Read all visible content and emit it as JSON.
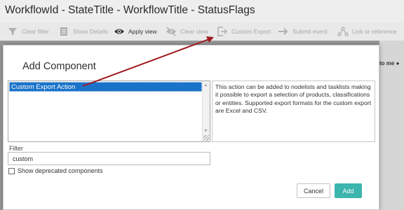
{
  "window": {
    "title": "WorkflowId - StateTitle - WorkflowTitle - StatusFlags"
  },
  "toolbar": {
    "items": [
      {
        "label": "Clear filter",
        "icon": "filter-icon",
        "enabled": false
      },
      {
        "label": "Show Details",
        "icon": "details-icon",
        "enabled": false
      },
      {
        "label": "Apply view",
        "icon": "eye-icon",
        "enabled": true
      },
      {
        "label": "Clear view",
        "icon": "eye-off-icon",
        "enabled": false
      },
      {
        "label": "Custom Export",
        "icon": "export-icon",
        "enabled": false
      },
      {
        "label": "Submit event",
        "icon": "submit-arrow-icon",
        "enabled": false
      },
      {
        "label": "Link or reference",
        "icon": "link-icon",
        "enabled": false
      }
    ]
  },
  "background": {
    "partial_text": "to me"
  },
  "dialog": {
    "title": "Add Component",
    "components": [
      {
        "label": "Custom Export Action",
        "selected": true
      }
    ],
    "description": "This action can be added to nodelists and tasklists making it possible to export a selection of products, classifications or entities. Supported export formats for the custom export are Excel and CSV.",
    "filter": {
      "label": "Filter",
      "value": "custom"
    },
    "deprecated": {
      "label": "Show deprecated components",
      "checked": false
    },
    "buttons": {
      "cancel": "Cancel",
      "add": "Add"
    }
  },
  "colors": {
    "selection": "#1a73c9",
    "add_button": "#3bb5ad",
    "annotation_arrow": "#a01a1f"
  }
}
